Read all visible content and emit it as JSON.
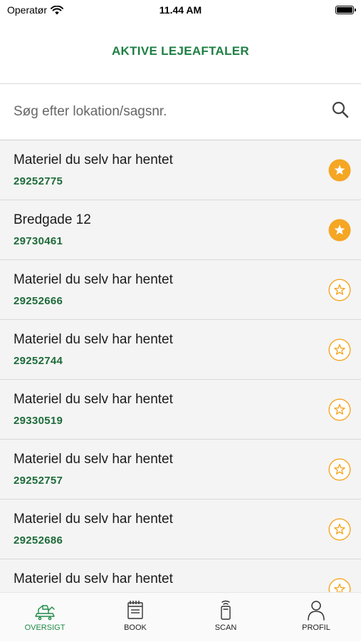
{
  "status": {
    "carrier": "Operatør",
    "time": "11.44 AM"
  },
  "header": {
    "title": "AKTIVE LEJEAFTALER"
  },
  "search": {
    "placeholder": "Søg efter lokation/sagsnr."
  },
  "items": [
    {
      "title": "Materiel du selv har hentet",
      "number": "29252775",
      "favorite": true
    },
    {
      "title": "Bredgade 12",
      "number": "29730461",
      "favorite": true
    },
    {
      "title": "Materiel du selv har hentet",
      "number": "29252666",
      "favorite": false
    },
    {
      "title": "Materiel du selv har hentet",
      "number": "29252744",
      "favorite": false
    },
    {
      "title": "Materiel du selv har hentet",
      "number": "29330519",
      "favorite": false
    },
    {
      "title": "Materiel du selv har hentet",
      "number": "29252757",
      "favorite": false
    },
    {
      "title": "Materiel du selv har hentet",
      "number": "29252686",
      "favorite": false
    },
    {
      "title": "Materiel du selv har hentet",
      "number": "",
      "favorite": false
    }
  ],
  "tabs": [
    {
      "label": "OVERSIGT",
      "icon": "machine-icon",
      "active": true
    },
    {
      "label": "BOOK",
      "icon": "notebook-icon",
      "active": false
    },
    {
      "label": "SCAN",
      "icon": "scanner-icon",
      "active": false
    },
    {
      "label": "PROFIL",
      "icon": "person-icon",
      "active": false
    }
  ],
  "colors": {
    "brand_green": "#1e7f43",
    "star_orange": "#f5a623",
    "row_bg": "#f4f4f4"
  }
}
